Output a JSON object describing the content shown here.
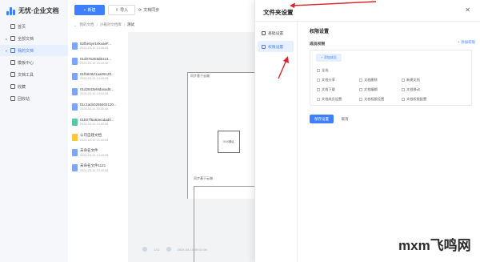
{
  "app": {
    "title": "无忧·企业文档"
  },
  "sidebar": {
    "items": [
      {
        "label": "首页",
        "icon": "home-icon",
        "caret": ""
      },
      {
        "label": "全部文档",
        "icon": "folder-icon",
        "caret": "▸"
      },
      {
        "label": "我的文档",
        "icon": "document-icon",
        "caret": "▾",
        "active": true
      },
      {
        "label": "模板中心",
        "icon": "template-icon",
        "caret": ""
      },
      {
        "label": "文档工具",
        "icon": "tool-icon",
        "caret": ""
      },
      {
        "label": "收藏",
        "icon": "star-icon",
        "caret": ""
      },
      {
        "label": "回收站",
        "icon": "trash-icon",
        "caret": ""
      }
    ]
  },
  "toolbar": {
    "new_label": "新建",
    "import_label": "导入",
    "sync_label": "文档同步"
  },
  "breadcrumb": {
    "back": "←",
    "items": [
      "我的文档",
      "沙箱对文档库"
    ],
    "current": "测试"
  },
  "files": [
    {
      "name": "52fbe5ye14kvaeF...",
      "date": "2024-03-10 13:40:08",
      "type": "doc"
    },
    {
      "name": "01d0762E8d6113...",
      "date": "2024-03-10 13:40:08",
      "type": "doc"
    },
    {
      "name": "01f5928Z1aa09120...",
      "date": "2024-03-10 13:40:08",
      "type": "doc"
    },
    {
      "name": "01d2843eMdaxad6...",
      "date": "2024-03-10 13:40:08",
      "type": "doc"
    },
    {
      "name": "01c1acb0265402110...",
      "date": "2024-03-10 13:40:08",
      "type": "doc"
    },
    {
      "name": "01b07f5a63e1dad0...",
      "date": "2024-03-10 13:40:08",
      "type": "green"
    },
    {
      "name": "公司自建文档",
      "date": "2024-03-10 13:40:08",
      "type": "folder"
    },
    {
      "name": "未命名文件",
      "date": "2024-03-10 13:40:08",
      "type": "doc"
    },
    {
      "name": "未命名文件1121",
      "date": "2024-03-10 13:40:08",
      "type": "doc"
    }
  ],
  "preview": {
    "page1_label": "同步基于云端",
    "box_label": "XXX确认",
    "page2_label": "同步基于云端",
    "bottom_count": "1/11",
    "bottom_date": "2024-03-10 09:01:05"
  },
  "modal": {
    "title": "文件夹设置",
    "close": "✕",
    "nav": [
      {
        "label": "基础设置",
        "icon": "info-icon"
      },
      {
        "label": "权限设置",
        "icon": "lock-icon",
        "active": true
      }
    ],
    "section_title": "权限设置",
    "subsection_title": "成员权限",
    "add_link": "+ 添加权限",
    "add_member_button": "+ 添加成员",
    "permissions": [
      {
        "label": "全选"
      },
      {
        "label": "文档分享"
      },
      {
        "label": "文档删除"
      },
      {
        "label": "新建文档"
      },
      {
        "label": "文档下载"
      },
      {
        "label": "文档编辑"
      },
      {
        "label": "文档移动"
      },
      {
        "label": "文档成员设置"
      },
      {
        "label": "文档权限设置"
      },
      {
        "label": "文档权限配置"
      }
    ],
    "save_label": "保存设置",
    "cancel_label": "取消"
  },
  "watermark": {
    "text": "mxm飞鸣网"
  },
  "colors": {
    "accent": "#3d7fff",
    "annotation": "#d9252a",
    "folder": "#ffc53d"
  }
}
